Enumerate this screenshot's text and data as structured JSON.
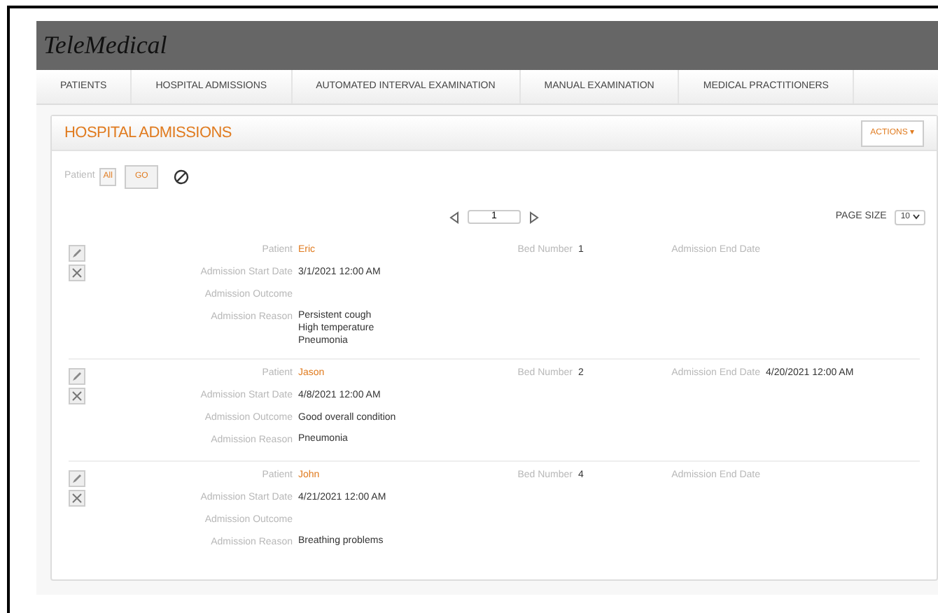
{
  "app": {
    "title": "TeleMedical"
  },
  "nav": [
    "PATIENTS",
    "HOSPITAL ADMISSIONS",
    "AUTOMATED INTERVAL EXAMINATION",
    "MANUAL EXAMINATION",
    "MEDICAL PRACTITIONERS"
  ],
  "panel": {
    "title": "HOSPITAL ADMISSIONS",
    "actions": "ACTIONS ▾"
  },
  "filter": {
    "label": "Patient",
    "value": "All",
    "go": "GO"
  },
  "pager": {
    "page": "1",
    "page_size_label": "PAGE SIZE",
    "page_size": "10"
  },
  "records": [
    {
      "patient": {
        "label": "Patient",
        "value": "Eric"
      },
      "bed": {
        "label": "Bed Number",
        "value": "1"
      },
      "end_date": {
        "label": "Admission End Date"
      },
      "start_date": {
        "label": "Admission Start Date",
        "value": "3/1/2021 12:00 AM"
      },
      "outcome": {
        "label": "Admission Outcome"
      },
      "reason": {
        "label": "Admission Reason",
        "lines": [
          "Persistent cough",
          "High temperature",
          "Pneumonia"
        ]
      }
    },
    {
      "patient": {
        "label": "Patient",
        "value": "Jason"
      },
      "bed": {
        "label": "Bed Number",
        "value": "2"
      },
      "end_date": {
        "label": "Admission End Date",
        "value": "4/20/2021 12:00 AM"
      },
      "start_date": {
        "label": "Admission Start Date",
        "value": "4/8/2021 12:00 AM"
      },
      "outcome": {
        "label": "Admission Outcome",
        "value": "Good overall condition"
      },
      "reason": {
        "label": "Admission Reason",
        "lines": [
          "Pneumonia"
        ]
      }
    },
    {
      "patient": {
        "label": "Patient",
        "value": "John"
      },
      "bed": {
        "label": "Bed Number",
        "value": "4"
      },
      "end_date": {
        "label": "Admission End Date"
      },
      "start_date": {
        "label": "Admission Start Date",
        "value": "4/21/2021 12:00 AM"
      },
      "outcome": {
        "label": "Admission Outcome"
      },
      "reason": {
        "label": "Admission Reason",
        "lines": [
          "Breathing problems"
        ]
      }
    }
  ]
}
